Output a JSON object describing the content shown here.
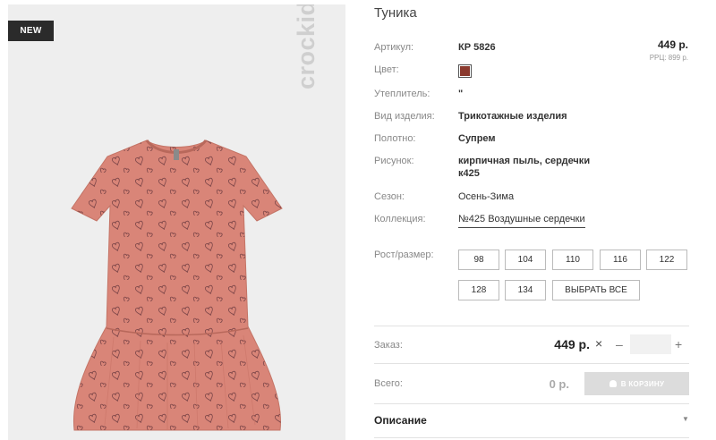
{
  "image": {
    "badge": "NEW",
    "brand": "crockid"
  },
  "product": {
    "title": "Туника",
    "price": "449 р.",
    "rrp": "РРЦ: 899 р."
  },
  "specs": {
    "article_label": "Артикул:",
    "article_value": "КР 5826",
    "color_label": "Цвет:",
    "color_swatch": "#8b3a2e",
    "insulation_label": "Утеплитель:",
    "insulation_value": "\"",
    "type_label": "Вид изделия:",
    "type_value": "Трикотажные изделия",
    "fabric_label": "Полотно:",
    "fabric_value": "Супрем",
    "pattern_label": "Рисунок:",
    "pattern_line1": "кирпичная пыль, сердечки",
    "pattern_line2": "к425",
    "season_label": "Сезон:",
    "season_value": "Осень-Зима",
    "collection_label": "Коллекция:",
    "collection_value": "№425 Воздушные сердечки"
  },
  "sizes": {
    "label": "Рост/размер:",
    "options": [
      "98",
      "104",
      "110",
      "116",
      "122",
      "128",
      "134"
    ],
    "select_all": "ВЫБРАТЬ ВСЕ"
  },
  "order": {
    "label": "Заказ:",
    "price": "449 р.",
    "times": "×",
    "minus": "–",
    "plus": "+",
    "qty": ""
  },
  "total": {
    "label": "Всего:",
    "value": "0 р.",
    "cart_button": "В КОРЗИНУ"
  },
  "description": {
    "title": "Описание"
  },
  "colors": {
    "shirt": "#d98578",
    "hearts": "#6b3a3f",
    "swatch": "#8b3a2e"
  }
}
